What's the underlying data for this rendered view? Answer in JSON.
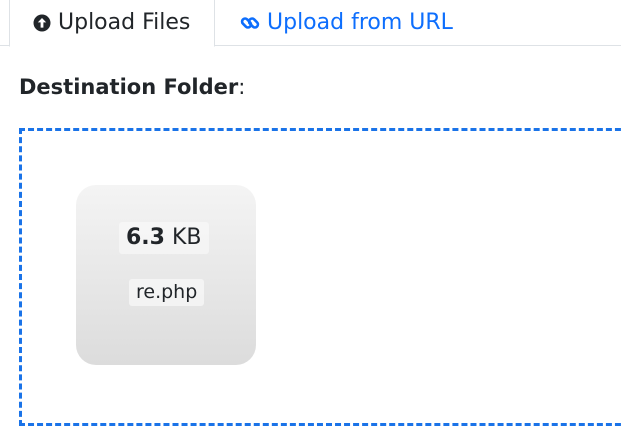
{
  "tabs": {
    "upload_files": {
      "label": "Upload Files",
      "icon": "arrow-up-circle-icon"
    },
    "upload_url": {
      "label": "Upload from URL",
      "icon": "link-icon"
    }
  },
  "destination": {
    "label": "Destination Folder",
    "separator": ":"
  },
  "colors": {
    "accent": "#0d6efd",
    "dropzone_border": "#1a73e8"
  },
  "file": {
    "size_value": "6.3",
    "size_unit": "KB",
    "name": "re.php"
  }
}
